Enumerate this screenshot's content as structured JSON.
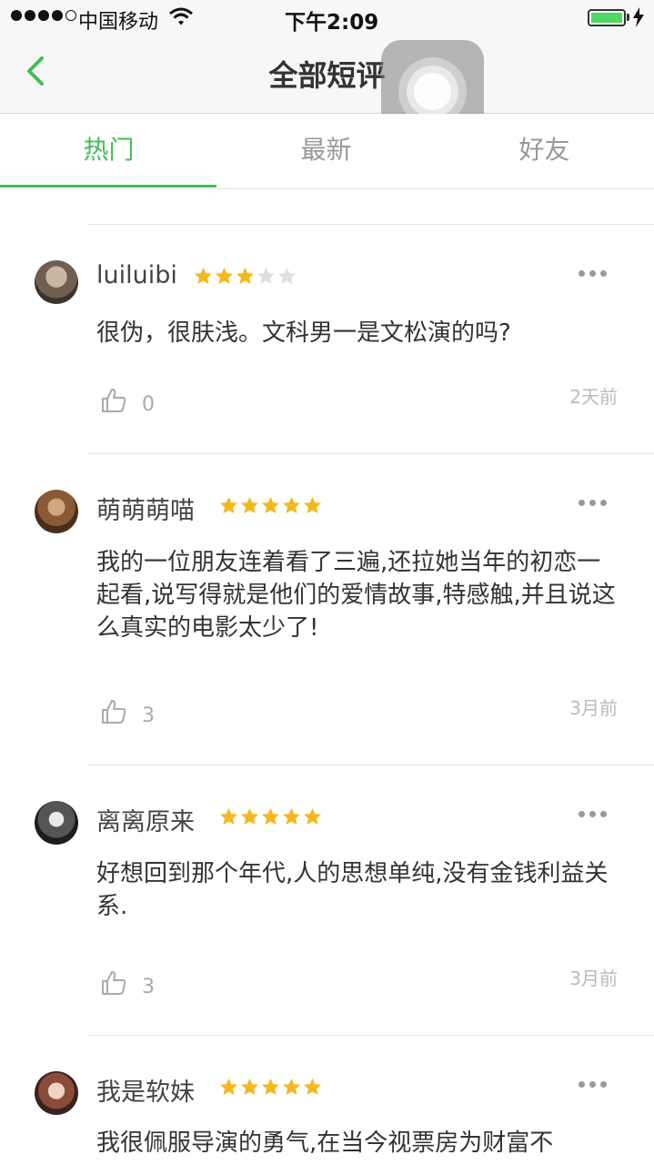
{
  "status_bar": {
    "carrier": "中国移动",
    "time": "下午2:09",
    "signal_icon": "signal-dots",
    "wifi_icon": "wifi-icon",
    "battery_icon": "battery-icon",
    "charging_icon": "bolt-icon"
  },
  "navbar": {
    "title": "全部短评",
    "back_icon": "chevron-left-icon"
  },
  "tabs": [
    {
      "label": "热门",
      "active": true
    },
    {
      "label": "最新",
      "active": false
    },
    {
      "label": "好友",
      "active": false
    }
  ],
  "colors": {
    "accent": "#42bd56",
    "star_filled": "#f5b81c",
    "star_empty": "#e0e0e0"
  },
  "comments": [
    {
      "username": "luiluibi",
      "rating": 3,
      "text": "很伪，很肤浅。文科男一是文松演的吗?",
      "likes": "0",
      "time": "2天前"
    },
    {
      "username": "萌萌萌喵",
      "rating": 5,
      "text": "我的一位朋友连着看了三遍,还拉她当年的初恋一起看,说写得就是他们的爱情故事,特感触,并且说这么真实的电影太少了!",
      "likes": "3",
      "time": "3月前"
    },
    {
      "username": "离离原来",
      "rating": 5,
      "text": "好想回到那个年代,人的思想单纯,没有金钱利益关系.",
      "likes": "3",
      "time": "3月前"
    },
    {
      "username": "我是软妹",
      "rating": 5,
      "text": "我很佩服导演的勇气,在当今视票房为财富不",
      "likes": "",
      "time": ""
    }
  ]
}
